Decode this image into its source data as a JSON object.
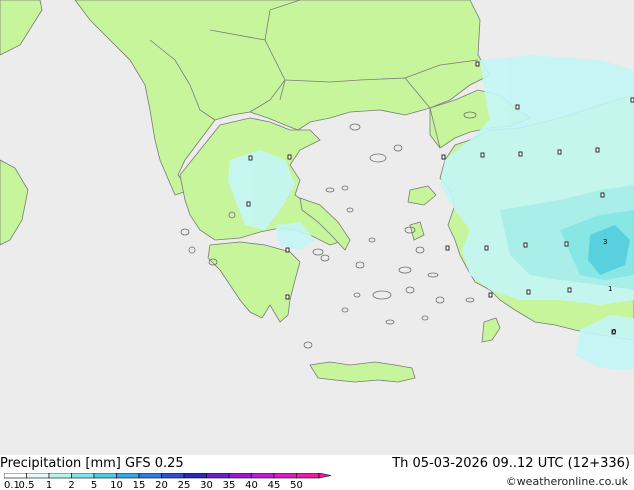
{
  "title": "Precipitation [mm]",
  "model": "GFS 0.25",
  "datetime": "Th 05-03-2026 09..12 UTC (12+336)",
  "credit": "©weatheronline.co.uk",
  "scale": {
    "labels": [
      "0.1",
      "0.5",
      "1",
      "2",
      "5",
      "10",
      "15",
      "20",
      "25",
      "30",
      "35",
      "40",
      "45",
      "50"
    ],
    "colors": [
      "#ffffff",
      "#e0fbfb",
      "#b8f3f3",
      "#80e6ee",
      "#4ccde6",
      "#30a8e6",
      "#2f7ae8",
      "#2c4fd8",
      "#2a2ab8",
      "#6a1fd0",
      "#9b18d6",
      "#c518d8",
      "#e318c8",
      "#f01aa8"
    ]
  },
  "station_values": [
    "3",
    "1",
    "0"
  ],
  "colors": {
    "sea": "#ececec",
    "land": "#c7f59c",
    "precip_light": "#c4f7f7",
    "precip_medium": "#80e6ee",
    "precip_heavy": "#4ccde6"
  }
}
